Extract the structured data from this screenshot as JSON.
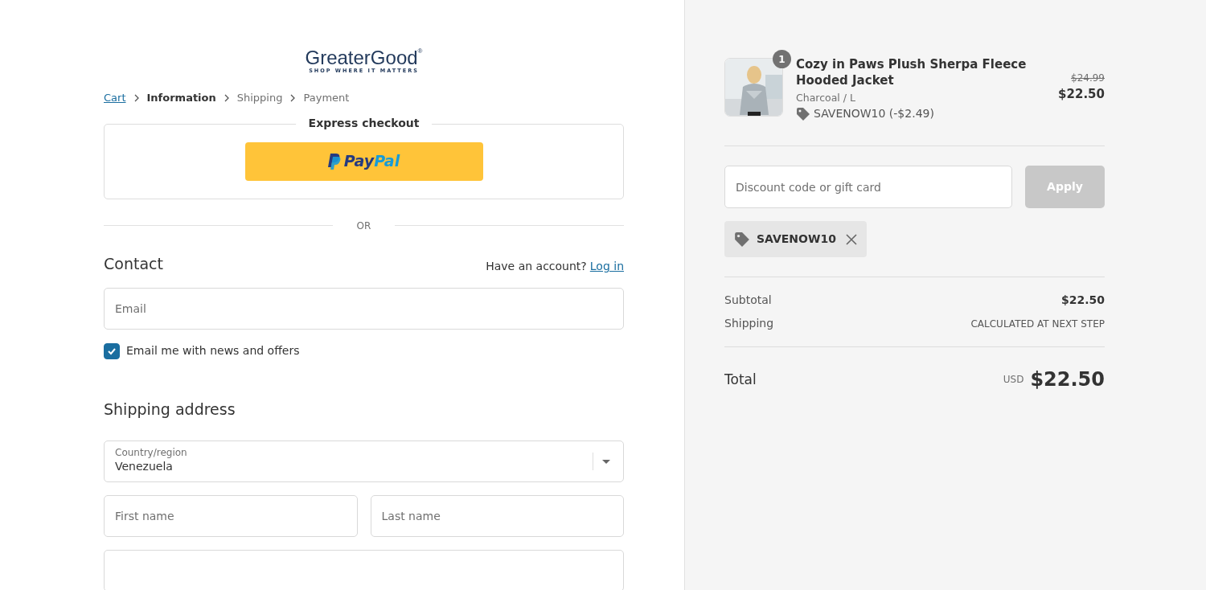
{
  "logo": {
    "name": "GreaterGood",
    "mark": "®",
    "tagline": "SHOP WHERE IT MATTERS"
  },
  "breadcrumbs": [
    {
      "label": "Cart",
      "kind": "link"
    },
    {
      "label": "Information",
      "kind": "current"
    },
    {
      "label": "Shipping",
      "kind": "upcoming"
    },
    {
      "label": "Payment",
      "kind": "upcoming"
    }
  ],
  "express_checkout": {
    "title": "Express checkout",
    "paypal": {
      "pay": "Pay",
      "pal": "Pal"
    }
  },
  "divider": "OR",
  "contact": {
    "title": "Contact",
    "account_prompt": "Have an account?",
    "login_link": "Log in",
    "email": {
      "placeholder": "Email"
    },
    "newsletter": {
      "label": "Email me with news and offers",
      "checked": true
    }
  },
  "shipping_address": {
    "title": "Shipping address",
    "country": {
      "label": "Country/region",
      "value": "Venezuela"
    },
    "first_name": {
      "placeholder": "First name"
    },
    "last_name": {
      "placeholder": "Last name"
    }
  },
  "order_summary": {
    "items": [
      {
        "quantity": "1",
        "name": "Cozy in Paws Plush Sherpa Fleece Hooded Jacket",
        "variant": "Charcoal / L",
        "discount": "SAVENOW10 (-$2.49)",
        "original_price": "$24.99",
        "price": "$22.50"
      }
    ],
    "discount_field": {
      "placeholder": "Discount code or gift card"
    },
    "apply_button": {
      "label": "Apply",
      "disabled": true
    },
    "applied_codes": [
      "SAVENOW10"
    ],
    "lines": [
      {
        "label": "Subtotal",
        "value": "$22.50",
        "kind": "amount"
      },
      {
        "label": "Shipping",
        "value": "CALCULATED AT NEXT STEP",
        "kind": "note"
      }
    ],
    "total": {
      "label": "Total",
      "currency": "USD",
      "value": "$22.50"
    }
  }
}
